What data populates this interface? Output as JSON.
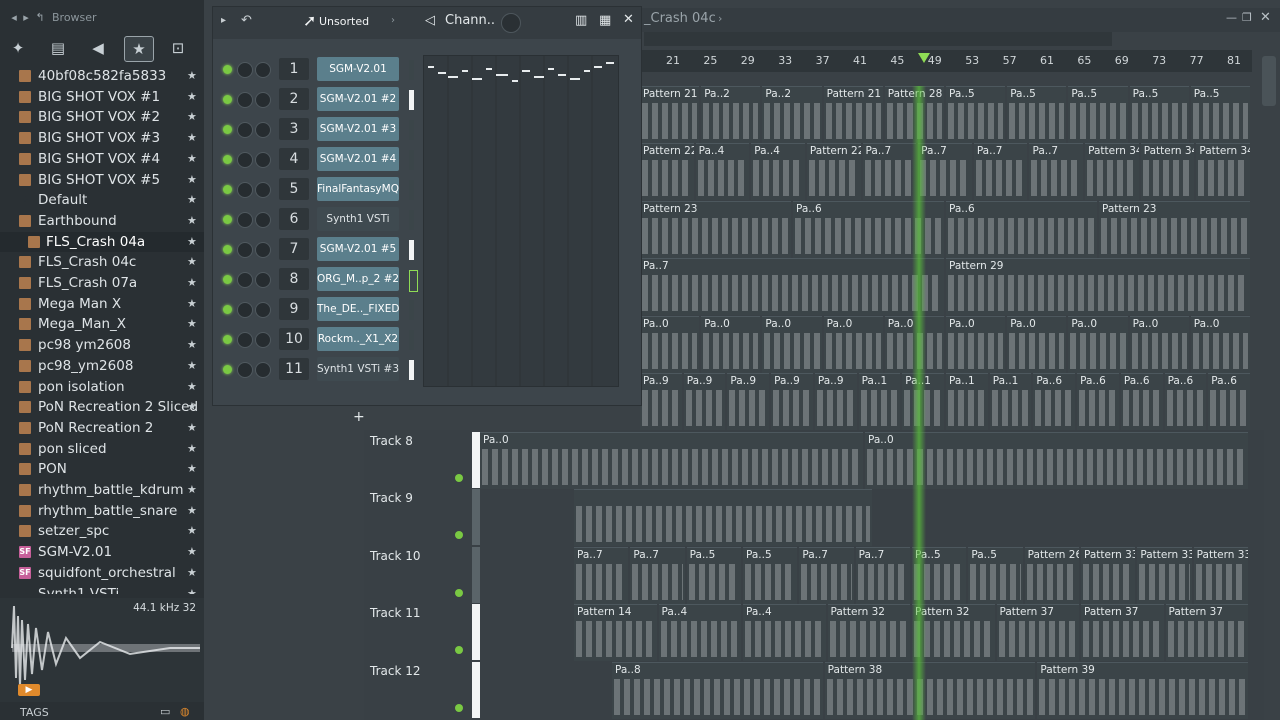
{
  "browser": {
    "title": "Browser",
    "items": [
      {
        "label": "40bf08c582fa5833",
        "type": "folder"
      },
      {
        "label": "BIG SHOT VOX #1",
        "type": "folder"
      },
      {
        "label": "BIG SHOT VOX #2",
        "type": "folder"
      },
      {
        "label": "BIG SHOT VOX #3",
        "type": "folder"
      },
      {
        "label": "BIG SHOT VOX #4",
        "type": "folder"
      },
      {
        "label": "BIG SHOT VOX #5",
        "type": "folder"
      },
      {
        "label": "Default",
        "type": "plugin"
      },
      {
        "label": "Earthbound",
        "type": "folder"
      },
      {
        "label": "FLS_Crash 04a",
        "type": "folder",
        "selected": true
      },
      {
        "label": "FLS_Crash 04c",
        "type": "folder"
      },
      {
        "label": "FLS_Crash 07a",
        "type": "folder"
      },
      {
        "label": "Mega Man X",
        "type": "folder"
      },
      {
        "label": "Mega_Man_X",
        "type": "folder"
      },
      {
        "label": "pc98 ym2608",
        "type": "folder"
      },
      {
        "label": "pc98_ym2608",
        "type": "folder"
      },
      {
        "label": "pon isolation",
        "type": "folder"
      },
      {
        "label": "PoN Recreation 2 Sliced",
        "type": "folder"
      },
      {
        "label": "PoN Recreation 2",
        "type": "folder"
      },
      {
        "label": "pon sliced",
        "type": "folder"
      },
      {
        "label": "PON",
        "type": "folder"
      },
      {
        "label": "rhythm_battle_kdrum",
        "type": "folder"
      },
      {
        "label": "rhythm_battle_snare",
        "type": "folder"
      },
      {
        "label": "setzer_spc",
        "type": "folder"
      },
      {
        "label": "SGM-V2.01",
        "type": "sf"
      },
      {
        "label": "squidfont_orchestral",
        "type": "sf"
      },
      {
        "label": "Synth1 VSTi",
        "type": "plugin"
      }
    ],
    "sample_info": "44.1 kHz 32",
    "tags_label": "TAGS"
  },
  "rack": {
    "filter": "Unsorted",
    "title": "Chann..",
    "channels": [
      {
        "num": "1",
        "name": "SGM-V2.01",
        "color": "#5b7f8c",
        "bar": "dark"
      },
      {
        "num": "2",
        "name": "SGM-V2.01 #2",
        "color": "#5b7f8c",
        "bar": "white"
      },
      {
        "num": "3",
        "name": "SGM-V2.01 #3",
        "color": "#5b7f8c",
        "bar": "dark"
      },
      {
        "num": "4",
        "name": "SGM-V2.01 #4",
        "color": "#5b7f8c",
        "bar": "dark"
      },
      {
        "num": "5",
        "name": "FinalFantasyMQ",
        "color": "#5b7f8c",
        "bar": "dark"
      },
      {
        "num": "6",
        "name": "Synth1 VSTi",
        "color": "plain",
        "bar": "dark"
      },
      {
        "num": "7",
        "name": "SGM-V2.01 #5",
        "color": "#5b7f8c",
        "bar": "white"
      },
      {
        "num": "8",
        "name": "ORG_M..p_2 #2",
        "color": "#5b7f8c",
        "bar": "green"
      },
      {
        "num": "9",
        "name": "The_DE.._FIXED",
        "color": "#5b7f8c",
        "bar": "dark"
      },
      {
        "num": "10",
        "name": "Rockm.._X1_X2",
        "color": "#5b7f8c",
        "bar": "dark"
      },
      {
        "num": "11",
        "name": "Synth1 VSTi #3",
        "color": "plain",
        "bar": "white"
      }
    ],
    "add_label": "+"
  },
  "playlist": {
    "title": "_Crash 04c",
    "ruler": [
      "21",
      "25",
      "29",
      "33",
      "37",
      "41",
      "45",
      "49",
      "53",
      "57",
      "61",
      "65",
      "69",
      "73",
      "77",
      "81"
    ],
    "tracks": [
      "Track 8",
      "Track 9",
      "Track 10",
      "Track 11",
      "Track 12"
    ],
    "upper_clips": [
      [
        "Pattern 21",
        "Pa..2",
        "Pa..2",
        "Pattern 21",
        "Pattern 28",
        "Pa..5",
        "Pa..5",
        "Pa..5",
        "Pa..5",
        "Pa..5"
      ],
      [
        "Pattern 22",
        "Pa..4",
        "Pa..4",
        "Pattern 22",
        "Pa..7",
        "Pa..7",
        "Pa..7",
        "Pa..7",
        "Pattern 34",
        "Pattern 34",
        "Pattern 34"
      ],
      [
        "Pattern 23",
        "Pa..6",
        "Pa..6",
        "Pattern 23"
      ],
      [
        "Pa..7",
        "Pattern 29"
      ],
      [
        "Pa..0",
        "Pa..0",
        "Pa..0",
        "Pa..0",
        "Pa..0",
        "Pa..0",
        "Pa..0",
        "Pa..0",
        "Pa..0",
        "Pa..0"
      ],
      [
        "Pa..9",
        "Pa..9",
        "Pa..9",
        "Pa..9",
        "Pa..9",
        "Pa..1",
        "Pa..1",
        "Pa..1",
        "Pa..1",
        "Pa..6",
        "Pa..6",
        "Pa..6",
        "Pa..6",
        "Pa..6"
      ]
    ],
    "track_clips": {
      "t8": [
        "Pa..0",
        "Pa..0"
      ],
      "t10": [
        "Pa..7",
        "Pa..7",
        "Pa..5",
        "Pa..5",
        "Pa..7",
        "Pa..7",
        "Pa..5",
        "Pa..5",
        "Pattern 26",
        "Pattern 33",
        "Pattern 33",
        "Pattern 33"
      ],
      "t11": [
        "Pattern 14",
        "Pa..4",
        "Pa..4",
        "Pattern 32",
        "Pattern 32",
        "Pattern 37",
        "Pattern 37",
        "Pattern 37"
      ],
      "t12": [
        "Pa..8",
        "Pattern 38",
        "Pattern 39"
      ]
    }
  }
}
